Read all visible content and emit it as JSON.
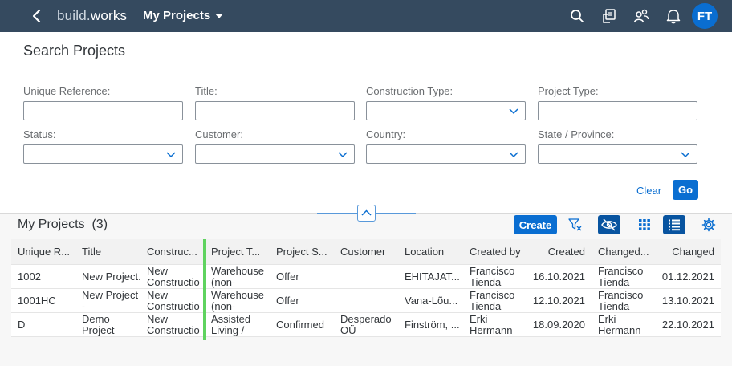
{
  "shell": {
    "brand_prefix": "build.",
    "brand_suffix": "works",
    "app_title": "My Projects",
    "avatar_initials": "FT",
    "icons": [
      "back-icon",
      "search-icon",
      "clipboard-icon",
      "people-icon",
      "bell-icon"
    ]
  },
  "filter": {
    "title": "Search Projects",
    "fields": [
      {
        "label": "Unique Reference:",
        "value": "",
        "type": "input"
      },
      {
        "label": "Title:",
        "value": "",
        "type": "input"
      },
      {
        "label": "Construction Type:",
        "value": "",
        "type": "select"
      },
      {
        "label": "Project Type:",
        "value": "",
        "type": "input"
      },
      {
        "label": "Status:",
        "value": "",
        "type": "select"
      },
      {
        "label": "Customer:",
        "value": "",
        "type": "select"
      },
      {
        "label": "Country:",
        "value": "",
        "type": "select"
      },
      {
        "label": "State / Province:",
        "value": "",
        "type": "select"
      }
    ],
    "clear_label": "Clear",
    "go_label": "Go"
  },
  "table": {
    "title": "My Projects",
    "count": "(3)",
    "create_label": "Create",
    "columns": [
      "Unique R...",
      "Title",
      "Construc...",
      "Project T...",
      "Project S...",
      "Customer",
      "Location",
      "Created by",
      "Created",
      "Changed...",
      "Changed"
    ],
    "rows": [
      [
        "1002",
        "New Project.",
        "New Constructio",
        "Warehouse (non-",
        "Offer",
        "",
        "EHITAJAT...",
        "Francisco Tienda",
        "16.10.2021",
        "Francisco Tienda",
        "01.12.2021"
      ],
      [
        "1001HC",
        "New Project -",
        "New Constructio",
        "Warehouse (non-",
        "Offer",
        "",
        "Vana-Lõu...",
        "Francisco Tienda",
        "12.10.2021",
        "Francisco Tienda",
        "13.10.2021"
      ],
      [
        "D",
        "Demo Project",
        "New Constructio",
        "Assisted Living /",
        "Confirmed",
        "Desperado OÜ",
        "Finström, ...",
        "Erki Hermann",
        "18.09.2020",
        "Erki Hermann",
        "22.10.2021"
      ]
    ]
  },
  "colors": {
    "shell": "#354a5f",
    "accent": "#0a6ed1",
    "highlight": "#5fd35f"
  }
}
